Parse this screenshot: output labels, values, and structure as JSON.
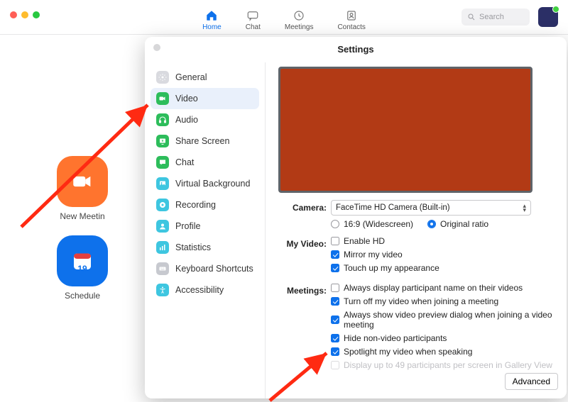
{
  "toolbar": {
    "items": [
      {
        "label": "Home"
      },
      {
        "label": "Chat"
      },
      {
        "label": "Meetings"
      },
      {
        "label": "Contacts"
      }
    ],
    "search_placeholder": "Search"
  },
  "quick_actions": {
    "new_meeting": "New Meetin",
    "schedule": "Schedule",
    "cal_day": "19"
  },
  "settings": {
    "title": "Settings",
    "sidebar": [
      {
        "label": "General",
        "icon": "gear",
        "color": "#d9dadf"
      },
      {
        "label": "Video",
        "icon": "camera",
        "color": "#2dbd5b"
      },
      {
        "label": "Audio",
        "icon": "headphones",
        "color": "#2dbd5b"
      },
      {
        "label": "Share Screen",
        "icon": "share",
        "color": "#2dbd5b"
      },
      {
        "label": "Chat",
        "icon": "chat",
        "color": "#2dbd5b"
      },
      {
        "label": "Virtual Background",
        "icon": "vb",
        "color": "#3ec6e0"
      },
      {
        "label": "Recording",
        "icon": "record",
        "color": "#3ec6e0"
      },
      {
        "label": "Profile",
        "icon": "profile",
        "color": "#3ec6e0"
      },
      {
        "label": "Statistics",
        "icon": "stats",
        "color": "#3ec6e0"
      },
      {
        "label": "Keyboard Shortcuts",
        "icon": "keyboard",
        "color": "#c7c9cf"
      },
      {
        "label": "Accessibility",
        "icon": "a11y",
        "color": "#3ec6e0"
      }
    ],
    "camera_label": "Camera:",
    "camera_value": "FaceTime HD Camera (Built-in)",
    "ratio": {
      "wide": "16:9 (Widescreen)",
      "orig": "Original ratio"
    },
    "myvideo_label": "My Video:",
    "myvideo": [
      {
        "text": "Enable HD",
        "checked": false
      },
      {
        "text": "Mirror my video",
        "checked": true
      },
      {
        "text": "Touch up my appearance",
        "checked": true
      }
    ],
    "meetings_label": "Meetings:",
    "meetings": [
      {
        "text": "Always display participant name on their videos",
        "checked": false
      },
      {
        "text": "Turn off my video when joining a meeting",
        "checked": true
      },
      {
        "text": "Always show video preview dialog when joining a video meeting",
        "checked": true
      },
      {
        "text": "Hide non-video participants",
        "checked": true
      },
      {
        "text": "Spotlight my video when speaking",
        "checked": true
      },
      {
        "text": "Display up to 49 participants per screen in Gallery View",
        "checked": false,
        "disabled": true
      }
    ],
    "advanced": "Advanced"
  }
}
